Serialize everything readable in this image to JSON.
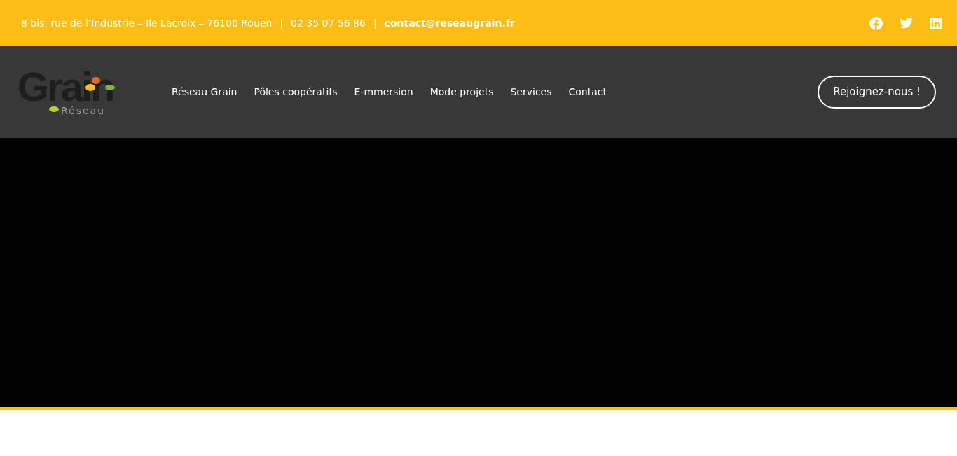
{
  "topbar": {
    "address": "8 bis, rue de l’Industrie – Ile Lacroix – 76100 Rouen",
    "separators": [
      "|",
      "|"
    ],
    "phone": "02 35 07 56 86",
    "email": "contact@reseaugrain.fr",
    "social": [
      {
        "kind": "facebook"
      },
      {
        "kind": "twitter"
      },
      {
        "kind": "linkedin"
      }
    ]
  },
  "header": {
    "logo": {
      "word": "Grain",
      "subword": "Réseau"
    },
    "nav": [
      {
        "label": "Réseau Grain"
      },
      {
        "label": "Pôles coopératifs"
      },
      {
        "label": "E-mmersion"
      },
      {
        "label": "Mode projets"
      },
      {
        "label": "Services"
      },
      {
        "label": "Contact"
      }
    ],
    "cta": "Rejoignez-nous !"
  }
}
